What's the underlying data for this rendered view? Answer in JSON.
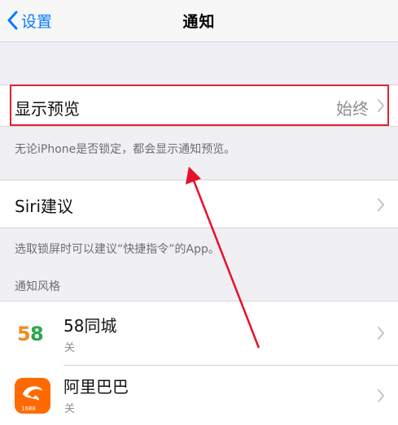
{
  "nav": {
    "back_label": "设置",
    "title": "通知"
  },
  "preview": {
    "label": "显示预览",
    "value": "始终",
    "footer": "无论iPhone是否锁定，都会显示通知预览。"
  },
  "siri": {
    "label": "Siri建议",
    "footer": "选取锁屏时可以建议“快捷指令”的App。"
  },
  "notification_style": {
    "header": "通知风格",
    "apps": [
      {
        "name": "58同城",
        "status": "关",
        "icon_text": "58"
      },
      {
        "name": "阿里巴巴",
        "status": "关",
        "icon_text": "1688"
      }
    ]
  },
  "colors": {
    "ios_blue": "#0a7aff",
    "highlight_red": "#e0222f",
    "arrow_red": "#e8102a"
  },
  "icons": [
    "chevron-left-icon",
    "chevron-right-icon",
    "58-app-icon",
    "alibaba-app-icon"
  ]
}
